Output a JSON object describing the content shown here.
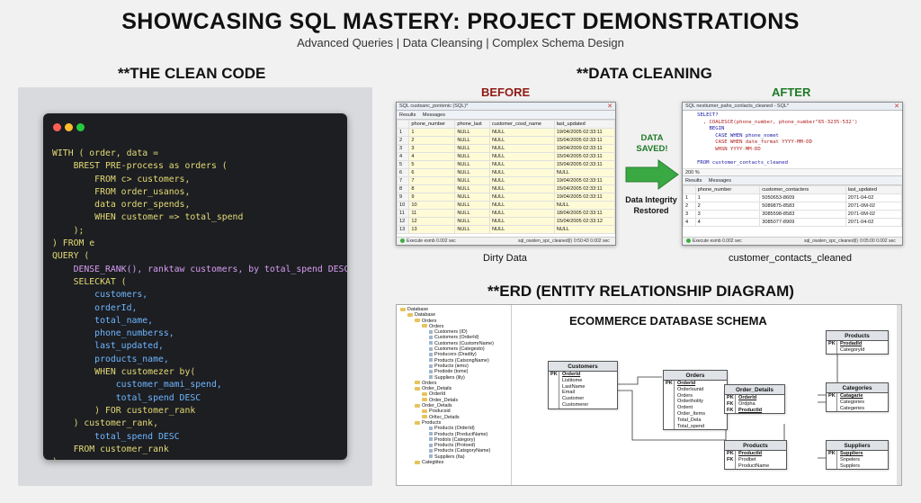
{
  "header": {
    "title": "SHOWCASING SQL MASTERY: PROJECT DEMONSTRATIONS",
    "subtitle": "Advanced Queries | Data Cleansing | Complex Schema Design"
  },
  "sections": {
    "clean_code": "**THE CLEAN CODE",
    "data_cleaning": "**DATA CLEANING",
    "erd": "**ERD (ENTITY RELATIONSHIP DIAGRAM)"
  },
  "colors": {
    "before": "#8e1b14",
    "after": "#1f7a26",
    "arrow": "#3aa843",
    "code_bg": "#1c1e22"
  },
  "code_lines": [
    "WITH ( order, data =",
    "    BREST PRE-process as orders (",
    "        FROM c> customers,",
    "        FROM order_usanos,",
    "        data order_spends,",
    "        WHEN customer => total_spend",
    "    );",
    ") FROM e",
    "QUERY (",
    "    DENSE_RANK(), ranktaw customers, by total_spend DESC,",
    "    SELECKAT (",
    "        customers,",
    "        orderId,",
    "        total_name,",
    "        phone_numberss,",
    "        last_updated,",
    "        products_name,",
    "        WHEN customezer by(",
    "            customer_mami_spend,",
    "            total_spend DESC",
    "        ) FOR customer_rank",
    "    ) customer_rank,",
    "        total_spend DESC",
    "    FROM customer_rank",
    ")"
  ],
  "before": {
    "label": "BEFORE",
    "window_title": "SQL custsanc_pontenic (SQL)*",
    "tabs": [
      "Results",
      "Messages"
    ],
    "columns": [
      "",
      "phone_number",
      "phone_last",
      "customer_cosd_name",
      "last_updated"
    ],
    "rows": [
      [
        "1",
        "1",
        "NULL",
        "NULL",
        "19/04/2005 02:33:11"
      ],
      [
        "2",
        "2",
        "NULL",
        "NULL",
        "15/04/2005 02:33:11"
      ],
      [
        "3",
        "3",
        "NULL",
        "NULL",
        "19/04/2009 02:33:11"
      ],
      [
        "4",
        "4",
        "NULL",
        "NULL",
        "15/04/2005 02:33:11"
      ],
      [
        "5",
        "5",
        "NULL",
        "NULL",
        "15/04/2005 02:33:11"
      ],
      [
        "6",
        "6",
        "NULL",
        "NULL",
        "NULL"
      ],
      [
        "7",
        "7",
        "NULL",
        "NULL",
        "19/04/2005 02:33:11"
      ],
      [
        "8",
        "8",
        "NULL",
        "NULL",
        "15/04/2005 02:33:11"
      ],
      [
        "9",
        "9",
        "NULL",
        "NULL",
        "19/04/2005 02:33:11"
      ],
      [
        "10",
        "10",
        "NULL",
        "NULL",
        "NULL"
      ],
      [
        "11",
        "11",
        "NULL",
        "NULL",
        "18/04/2005 02:33:11"
      ],
      [
        "12",
        "12",
        "NULL",
        "NULL",
        "15/04/2005 02:33:12"
      ],
      [
        "13",
        "13",
        "NULL",
        "NULL",
        "NULL"
      ]
    ],
    "status_left": "Execute esmb 0.002 sec",
    "status_mid": "sql_owslen_spc_cleaned(l)",
    "status_right": "0:50:43  0.002 sec",
    "caption": "Dirty Data"
  },
  "middle": {
    "saved": "DATA\nSAVED!",
    "integrity": "Data Integrity\nRestored"
  },
  "after": {
    "label": "AFTER",
    "window_title": "SQL nestiumer_pahs_conlacts_cleaned - SQL*",
    "sql_lines": [
      "SELECT?",
      "  , COALESCE(phone_number, phone_number\"65-3235-532')",
      "    BEGIN",
      "      CASE WHEN phone_nomet",
      "      CASE WHEN date_format YYYY-MM-DD",
      "      WHSN YYYY-MM-DD",
      "",
      "FROM customer_contacts_cleaned"
    ],
    "zoom": "200 %",
    "tabs": [
      "Results",
      "Messages"
    ],
    "columns": [
      "",
      "phone_number",
      "customer_contacters",
      "last_updated"
    ],
    "rows": [
      [
        "1",
        "1",
        "5050653-8609",
        "2071-04-02"
      ],
      [
        "2",
        "2",
        "5089875-8583",
        "2071-0M-02"
      ],
      [
        "3",
        "3",
        "3085598-8583",
        "2071-0M-02"
      ],
      [
        "4",
        "4",
        "3085077-8909",
        "2071-04-02"
      ]
    ],
    "status_left": "Execute esmb 0.002 sec",
    "status_mid": "sql_owslen_spc_cleaned(l)",
    "status_right": "0:05:00  0.002 sec",
    "caption": "customer_contacts_cleaned"
  },
  "erd": {
    "title": "ECOMMERCE DATABASE SCHEMA",
    "tree": [
      {
        "t": "Database",
        "d": 0,
        "k": "f"
      },
      {
        "t": "Database",
        "d": 1,
        "k": "f"
      },
      {
        "t": "Orders",
        "d": 2,
        "k": "f"
      },
      {
        "t": "Orders",
        "d": 3,
        "k": "f"
      },
      {
        "t": "Customers (ID)",
        "d": 4,
        "k": "t"
      },
      {
        "t": "Customers (OrderId)",
        "d": 4,
        "k": "t"
      },
      {
        "t": "Customers (CustomrName)",
        "d": 4,
        "k": "t"
      },
      {
        "t": "Customers (Categesto)",
        "d": 4,
        "k": "t"
      },
      {
        "t": "Producers (Dradity)",
        "d": 4,
        "k": "t"
      },
      {
        "t": "Products (CatsongName)",
        "d": 4,
        "k": "t"
      },
      {
        "t": "Products (iems)",
        "d": 4,
        "k": "t"
      },
      {
        "t": "Prodode (tome)",
        "d": 4,
        "k": "t"
      },
      {
        "t": "Suppliers (lily)",
        "d": 4,
        "k": "t"
      },
      {
        "t": "Orders",
        "d": 2,
        "k": "f"
      },
      {
        "t": "Order_Details",
        "d": 2,
        "k": "f"
      },
      {
        "t": "OrderId",
        "d": 3,
        "k": "f"
      },
      {
        "t": "Order_Detals",
        "d": 3,
        "k": "f"
      },
      {
        "t": "Order_Oetails",
        "d": 2,
        "k": "f"
      },
      {
        "t": "Prsducsid",
        "d": 3,
        "k": "f"
      },
      {
        "t": "Orltsc_Details",
        "d": 3,
        "k": "f"
      },
      {
        "t": "Products",
        "d": 2,
        "k": "f"
      },
      {
        "t": "Products (OrderId)",
        "d": 4,
        "k": "t"
      },
      {
        "t": "Products (PreductName)",
        "d": 4,
        "k": "t"
      },
      {
        "t": "Prodols (Category)",
        "d": 4,
        "k": "t"
      },
      {
        "t": "Products (Protoed)",
        "d": 4,
        "k": "t"
      },
      {
        "t": "Products (CatsgoryName)",
        "d": 4,
        "k": "t"
      },
      {
        "t": "Suppliers (Ita)",
        "d": 4,
        "k": "t"
      },
      {
        "t": "Categtites",
        "d": 2,
        "k": "f"
      }
    ],
    "entities": {
      "customers": {
        "name": "Customers",
        "fields": [
          [
            "PK",
            "OrderId",
            true
          ],
          [
            "",
            "Listitome",
            false
          ],
          [
            "",
            "LastName",
            false
          ],
          [
            "",
            "Email",
            false
          ],
          [
            "",
            "Customer",
            false
          ],
          [
            "",
            "Customerer",
            false
          ]
        ]
      },
      "orders": {
        "name": "Orders",
        "fields": [
          [
            "PK",
            "OrderId",
            true
          ],
          [
            "",
            "OrderIsunid",
            false
          ],
          [
            "",
            "Orders",
            false
          ],
          [
            "",
            "Ordertholity",
            false
          ],
          [
            "",
            "Ordent",
            false
          ],
          [
            "",
            "Order_Items",
            false
          ],
          [
            "",
            "Total_Dela",
            false
          ],
          [
            "",
            "Total_spend",
            false
          ]
        ]
      },
      "order_details": {
        "name": "Order_Details",
        "fields": [
          [
            "PK",
            "OrderId",
            true
          ],
          [
            "FK",
            "Ordpha",
            false
          ],
          [
            "FK",
            "ProductId",
            true
          ]
        ]
      },
      "products_top": {
        "name": "Products",
        "fields": [
          [
            "PK",
            "ProdadId",
            true
          ],
          [
            "",
            "CategoryId",
            false
          ]
        ]
      },
      "categories": {
        "name": "Categories",
        "fields": [
          [
            "PK",
            "Catagarie",
            true
          ],
          [
            "",
            "Categories",
            false
          ],
          [
            "",
            "Categeries",
            false
          ]
        ]
      },
      "products": {
        "name": "Products",
        "fields": [
          [
            "PK",
            "ProductId",
            true
          ],
          [
            "FK",
            "Prodbet",
            false
          ],
          [
            "",
            "ProductName",
            false
          ]
        ]
      },
      "suppliers": {
        "name": "Suppliers",
        "fields": [
          [
            "PK",
            "Suppliers",
            true
          ],
          [
            "",
            "Snpelers",
            false
          ],
          [
            "",
            "Supplers",
            false
          ]
        ]
      }
    }
  }
}
